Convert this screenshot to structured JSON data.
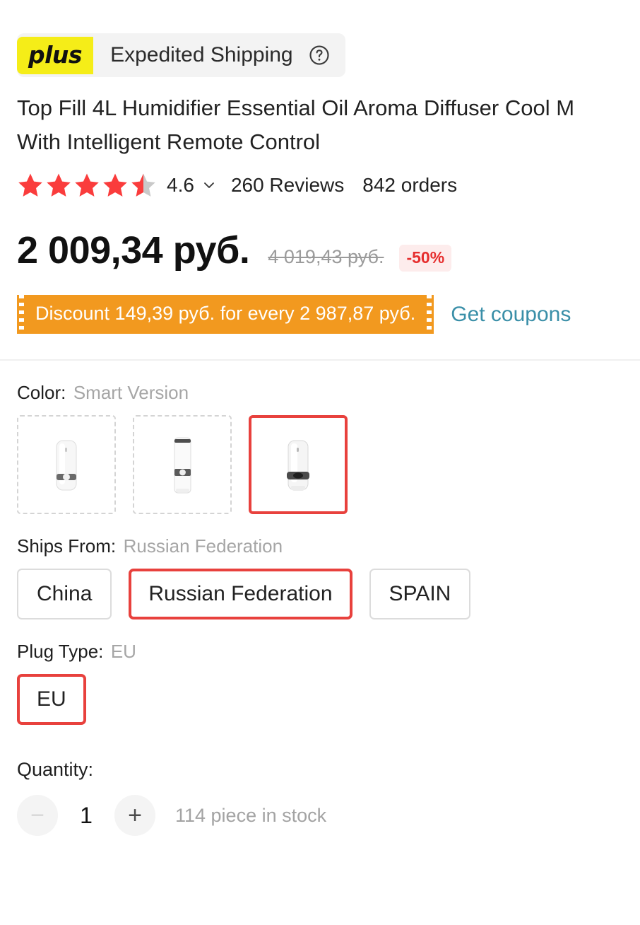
{
  "banner": {
    "badge_label": "plus",
    "shipping_label": "Expedited Shipping",
    "help_icon": "question-circle-icon",
    "badge_bg": "#f5ed18",
    "bar_bg": "#f3f3f3"
  },
  "product": {
    "title_line1": "Top Fill 4L Humidifier Essential Oil Aroma Diffuser Cool M",
    "title_line2": "With Intelligent Remote Control"
  },
  "rating": {
    "value": "4.6",
    "stars_filled": 4,
    "stars_half": 1,
    "stars_total": 5,
    "star_color": "#fa3c3c",
    "star_empty_color": "#c9c9c9",
    "chevron_icon": "chevron-down-icon",
    "reviews": "260 Reviews",
    "orders": "842 orders"
  },
  "price": {
    "current": "2 009,34 руб.",
    "original": "4 019,43 руб.",
    "discount_badge": "-50%",
    "discount_color": "#e62e2e",
    "discount_bg": "#fdecec"
  },
  "coupon": {
    "text": "Discount 149,39 руб. for every 2 987,87 руб.",
    "link_label": "Get coupons",
    "ticket_bg": "#f2991f",
    "link_color": "#3a8fa8"
  },
  "options": {
    "color": {
      "label": "Color:",
      "value": "Smart Version",
      "swatches": [
        {
          "name": "humidifier-white-variant-1",
          "selected": false
        },
        {
          "name": "humidifier-white-variant-2",
          "selected": false
        },
        {
          "name": "humidifier-smart-version",
          "selected": true
        }
      ]
    },
    "ships_from": {
      "label": "Ships From:",
      "value": "Russian Federation",
      "choices": [
        {
          "label": "China",
          "selected": false
        },
        {
          "label": "Russian Federation",
          "selected": true
        },
        {
          "label": "SPAIN",
          "selected": false
        }
      ]
    },
    "plug_type": {
      "label": "Plug Type:",
      "value": "EU",
      "choices": [
        {
          "label": "EU",
          "selected": true
        }
      ]
    }
  },
  "quantity": {
    "label": "Quantity:",
    "value": "1",
    "minus_label": "−",
    "plus_label": "+",
    "stock_text": "114 piece in stock"
  },
  "theme": {
    "selected_border": "#e8413d",
    "text_primary": "#222222",
    "text_muted": "#a6a6a6"
  }
}
